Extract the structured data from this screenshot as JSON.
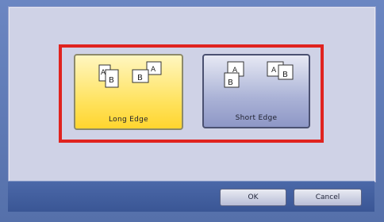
{
  "options": {
    "long_edge": {
      "label": "Long Edge",
      "icon": "duplex-long-edge-icon"
    },
    "short_edge": {
      "label": "Short Edge",
      "icon": "duplex-short-edge-icon"
    }
  },
  "buttons": {
    "ok": "OK",
    "cancel": "Cancel"
  },
  "colors": {
    "highlight_border": "#e0231f",
    "selected_option": "#ffe25c",
    "background": "#5f78b0"
  }
}
